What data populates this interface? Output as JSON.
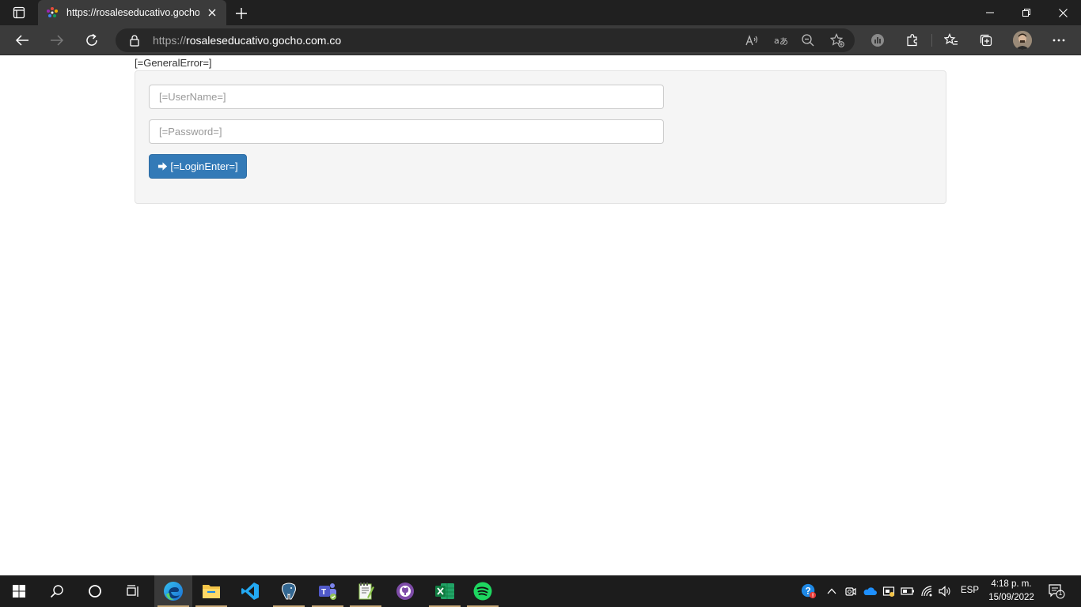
{
  "browser": {
    "tab_title": "https://rosaleseducativo.gocho.co",
    "url_protocol": "https://",
    "url_host": "rosaleseducativo.gocho.com.co"
  },
  "page": {
    "general_error": "[=GeneralError=]",
    "username_placeholder": "[=UserName=]",
    "password_placeholder": "[=Password=]",
    "login_label": "[=LoginEnter=]"
  },
  "taskbar": {
    "language": "ESP",
    "time": "4:18 p. m.",
    "date": "15/09/2022",
    "notification_count": "1"
  },
  "colors": {
    "primary": "#337ab7",
    "panel_bg": "#f5f5f5",
    "chrome_dark": "#202020",
    "toolbar": "#3b3b3b"
  }
}
